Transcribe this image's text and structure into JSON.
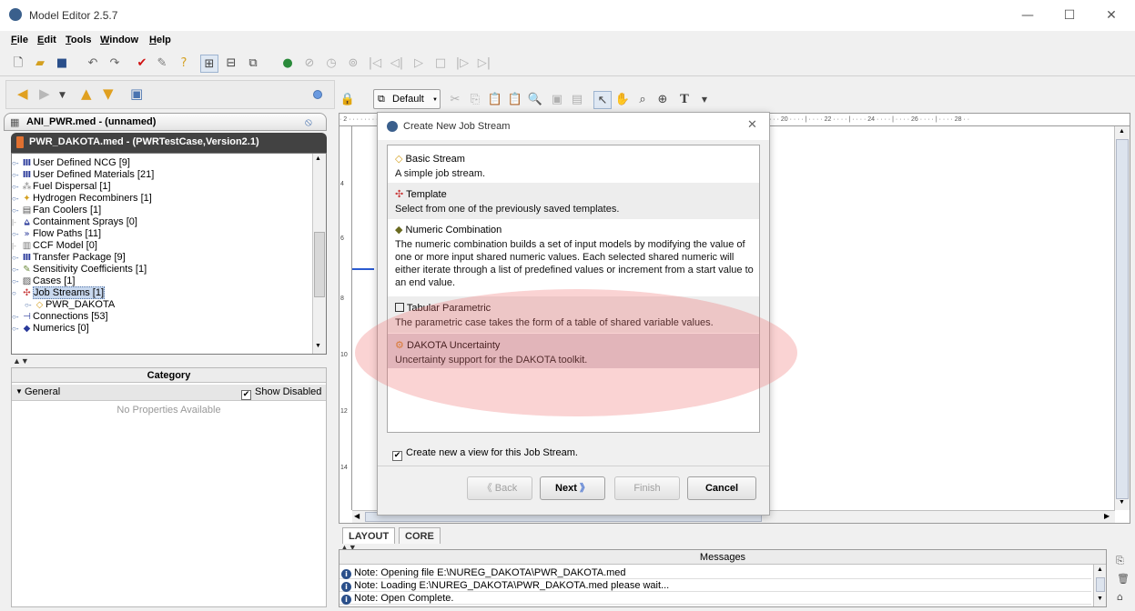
{
  "window": {
    "title": "Model Editor 2.5.7",
    "minimize": "—",
    "maximize": "☐",
    "close": "✕"
  },
  "menu": [
    {
      "label": "File",
      "ul": "F",
      "rest": "ile"
    },
    {
      "label": "Edit",
      "ul": "E",
      "rest": "dit"
    },
    {
      "label": "Tools",
      "ul": "T",
      "rest": "ools"
    },
    {
      "label": "Window",
      "ul": "W",
      "rest": "indow"
    },
    {
      "label": "Help",
      "ul": "H",
      "rest": "elp"
    }
  ],
  "left": {
    "ani_tab": "ANI_PWR.med - (unnamed)",
    "pwr_tab": "PWR_DAKOTA.med - (PWRTestCase,Version2.1)",
    "tree": [
      "User Defined NCG [9]",
      "User Defined Materials [21]",
      "Fuel Dispersal [1]",
      "Hydrogen Recombiners [1]",
      "Fan Coolers [1]",
      "Containment Sprays [0]",
      "Flow Paths [11]",
      "CCF Model [0]",
      "Transfer Package [9]",
      "Sensitivity Coefficients [1]",
      "Cases [1]",
      "Job Streams [1]",
      "PWR_DAKOTA",
      "Connections [53]",
      "Numerics [0]"
    ],
    "props": {
      "category": "Category",
      "general": "General",
      "show_disabled": "Show Disabled",
      "empty": "No Properties Available"
    }
  },
  "editor": {
    "default_view": "Default",
    "ruler_top": "· 2 · · · · · · · · · · · · · · · · · · · · · · · · · · · · · · · · · · · · · · · · · · · · · · · · · · · · · · · · · · · · · · · · · · · · · · · · · · · · · · · · · · · · · · · · · · · · · · · | · · · · 18 · · · · | · · · · 20 · · · · | · · · · 22 · · · · | · · · · 24 · · · · | · · · · 26 · · · · | · · · · 28 · ·",
    "ruler_left": [
      "4",
      "6",
      "8",
      "10",
      "12",
      "14"
    ],
    "tabs": [
      "LAYOUT",
      "CORE"
    ]
  },
  "messages": {
    "header": "Messages",
    "rows": [
      "Note: Opening file E:\\NUREG_DAKOTA\\PWR_DAKOTA.med",
      "Note: Loading E:\\NUREG_DAKOTA\\PWR_DAKOTA.med please wait...",
      "Note: Open Complete."
    ]
  },
  "dialog": {
    "title": "Create New Job Stream",
    "options": [
      {
        "title": "Basic Stream",
        "desc": "A simple job stream."
      },
      {
        "title": "Template",
        "desc": "Select from one of the previously saved templates."
      },
      {
        "title": "Numeric Combination",
        "desc": "The numeric combination builds a set of input models by modifying the value of one or more input shared numeric values. Each selected shared numeric will either iterate through a list of predefined values or increment from a start value to an end value."
      },
      {
        "title": "Tabular Parametric",
        "desc": "The parametric case takes the form of a table of shared variable values."
      },
      {
        "title": "DAKOTA Uncertainty",
        "desc": "Uncertainty support for the DAKOTA toolkit."
      }
    ],
    "create_view": "Create new a view for this Job Stream.",
    "buttons": {
      "back": "Back",
      "next": "Next",
      "finish": "Finish",
      "cancel": "Cancel"
    }
  }
}
